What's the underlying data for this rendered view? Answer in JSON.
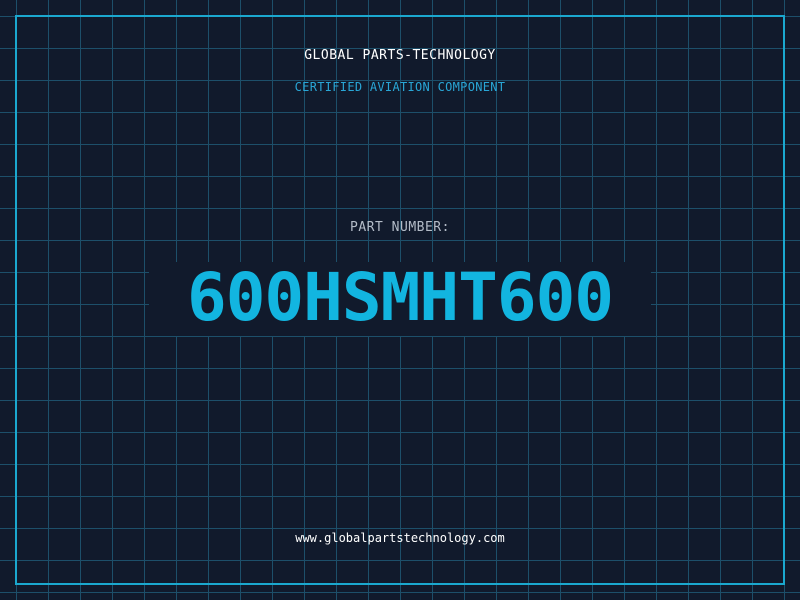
{
  "header": {
    "company_name": "GLOBAL PARTS-TECHNOLOGY",
    "tagline": "CERTIFIED AVIATION COMPONENT"
  },
  "part": {
    "label": "PART NUMBER:",
    "number": "600HSMHT600"
  },
  "footer": {
    "website": "www.globalpartstechnology.com"
  },
  "colors": {
    "background": "#111a2c",
    "grid": "#1d4f6a",
    "accent": "#1ba8cf",
    "part_number": "#12b5e0"
  }
}
